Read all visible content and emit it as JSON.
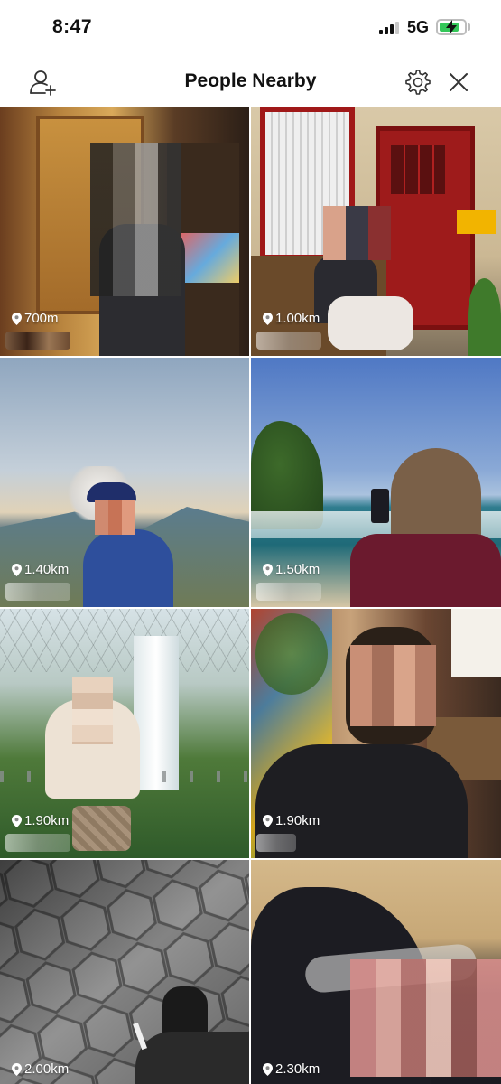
{
  "status_bar": {
    "time": "8:47",
    "network": "5G",
    "battery_level": 0.8,
    "battery_color": "#34c759"
  },
  "header": {
    "title": "People Nearby",
    "left_icon": "add-person-icon",
    "right_icons": [
      "gear-icon",
      "close-icon"
    ]
  },
  "people": [
    {
      "distance": "700m"
    },
    {
      "distance": "1.00km"
    },
    {
      "distance": "1.40km"
    },
    {
      "distance": "1.50km"
    },
    {
      "distance": "1.90km"
    },
    {
      "distance": "1.90km"
    },
    {
      "distance": "2.00km"
    },
    {
      "distance": "2.30km"
    }
  ],
  "pin_icon": "location-pin-icon"
}
